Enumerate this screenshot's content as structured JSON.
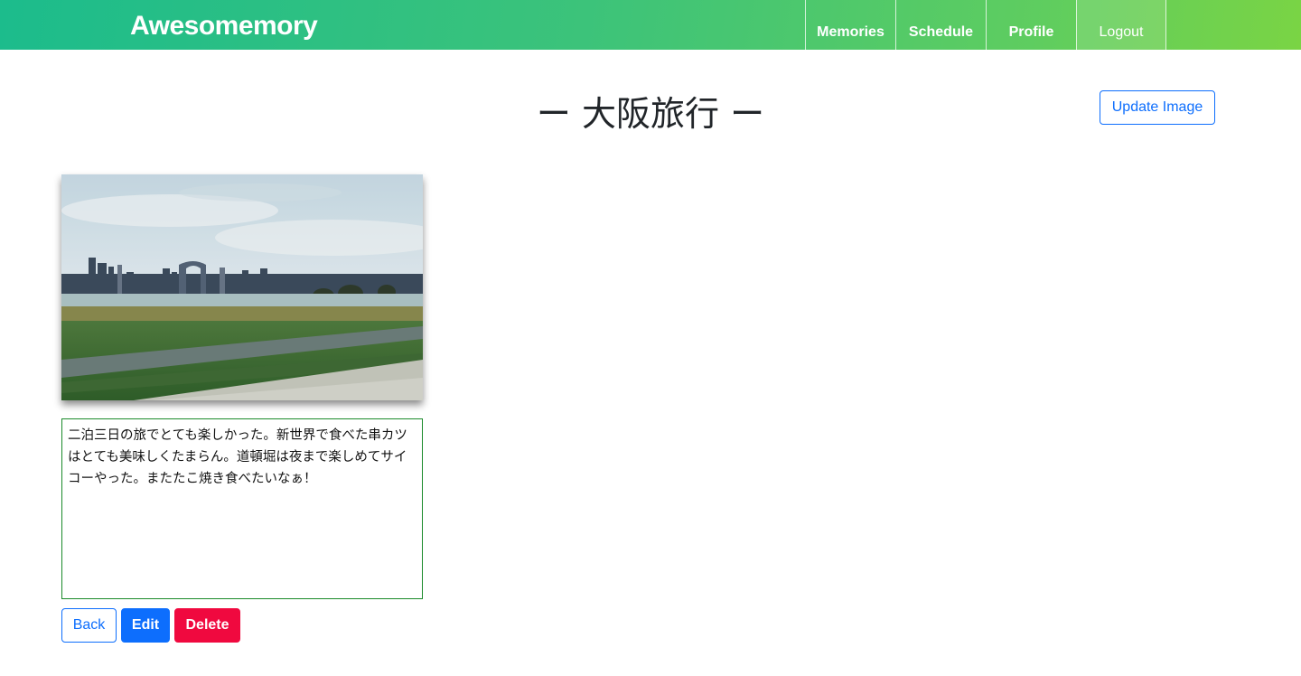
{
  "header": {
    "brand": "Awesomemory",
    "nav": [
      {
        "label": "Memories"
      },
      {
        "label": "Schedule"
      },
      {
        "label": "Profile"
      },
      {
        "label": "Logout"
      }
    ]
  },
  "main": {
    "title": "ー 大阪旅行 ー",
    "update_image_label": "Update Image",
    "memo_text": "二泊三日の旅でとても楽しかった。新世界で食べた串カツはとても美味しくたまらん。道頓堀は夜まで楽しめてサイコーやった。またたこ焼き食べたいなぁ！",
    "buttons": {
      "back": "Back",
      "edit": "Edit",
      "delete": "Delete"
    }
  },
  "colors": {
    "nav_gradient_start": "#1cbc8c",
    "nav_gradient_end": "#7ad444",
    "primary": "#0d6efd",
    "danger": "#f0093f",
    "memo_border": "#1a8a2a"
  }
}
